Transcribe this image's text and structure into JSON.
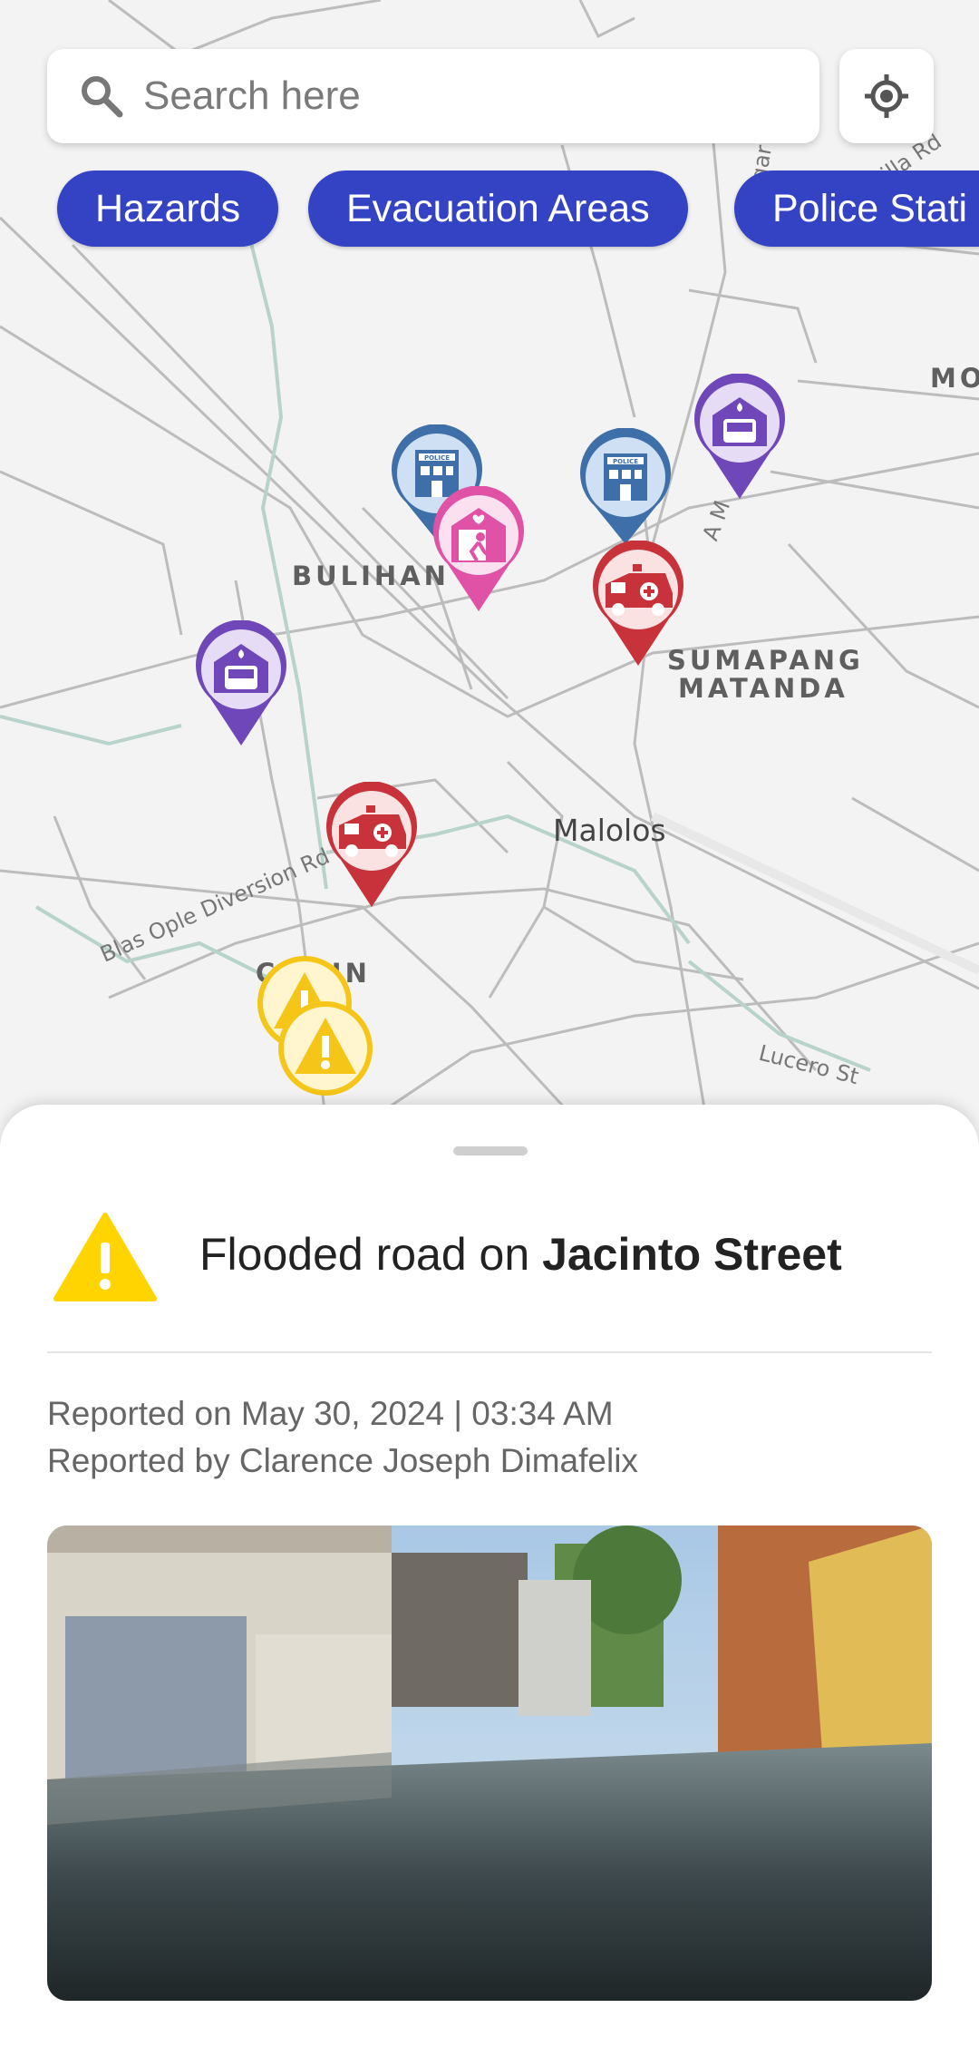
{
  "search": {
    "placeholder": "Search here",
    "icon": "search-icon"
  },
  "location_button": {
    "icon": "my-location-icon"
  },
  "filters": [
    "Hazards",
    "Evacuation Areas",
    "Police Stati"
  ],
  "colors": {
    "chip": "#3443c4",
    "hazard": "#f5c518",
    "police": "#3f6fa8",
    "fire": "#6f47b8",
    "ambulance": "#c8323b",
    "evacuation": "#e052a6"
  },
  "map": {
    "labels": {
      "bulihan": "BULIHAN",
      "sumapang_1": "SUMAPANG",
      "sumapang_2": "MATANDA",
      "malolos": "Malolos",
      "mo": "MO",
      "gin": "GIN",
      "c": "C"
    },
    "streets": {
      "blas_ople": "Blas Ople Diversion Rd",
      "lucero": "Lucero St",
      "am": "A M",
      "gar": "gar",
      "illa_rd": "illa Rd"
    },
    "police_sign": "POLICE"
  },
  "report": {
    "title_prefix": "Flooded road on ",
    "title_street": "Jacinto Street",
    "reported_on": "Reported on May 30, 2024 | 03:34 AM",
    "reported_by": "Reported by Clarence Joseph Dimafelix"
  }
}
